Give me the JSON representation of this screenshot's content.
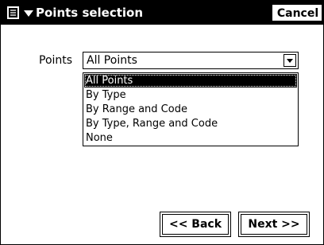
{
  "window": {
    "title": "Points selection",
    "menu_icon": "menu-list-icon",
    "cancel_label": "Cancel"
  },
  "form": {
    "points_label": "Points",
    "points_value": "All Points",
    "options": [
      "All Points",
      "By Type",
      "By Range and Code",
      "By Type, Range and Code",
      "None"
    ],
    "selected_index": 0
  },
  "footer": {
    "back_label": "<< Back",
    "next_label": "Next >>"
  }
}
